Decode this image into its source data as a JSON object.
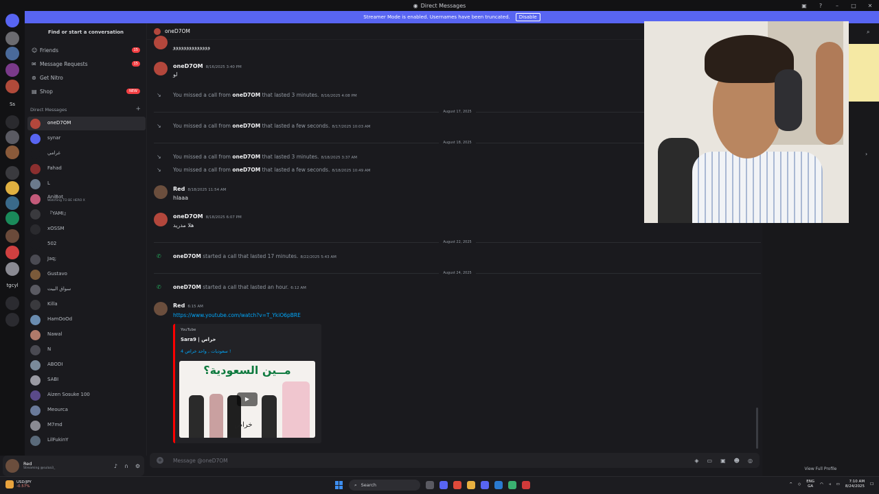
{
  "window": {
    "title": "Direct Messages"
  },
  "banner": {
    "text": "Streamer Mode is enabled. Usernames have been truncated.",
    "button": "Disable"
  },
  "sidebar": {
    "search": "Find or start a conversation",
    "nav": [
      {
        "label": "Friends",
        "icon": "friends-icon",
        "badge": "15"
      },
      {
        "label": "Message Requests",
        "icon": "mail-icon",
        "badge": "15"
      },
      {
        "label": "Get Nitro",
        "icon": "nitro-icon",
        "badge": ""
      },
      {
        "label": "Shop",
        "icon": "shop-icon",
        "badge": "NEW"
      }
    ],
    "dm_header": "Direct Messages",
    "dms": [
      {
        "name": "oneD7OM",
        "sub": "",
        "color": "#b3473c"
      },
      {
        "name": "synar",
        "sub": "",
        "color": "#5865f2"
      },
      {
        "name": "غرامي",
        "sub": "",
        "color": "#1a1a1e"
      },
      {
        "name": "Fahad",
        "sub": "",
        "color": "#8b2f2f"
      },
      {
        "name": "L",
        "sub": "",
        "color": "#6b7a8c"
      },
      {
        "name": "AniBot",
        "sub": "Watching TO BE HERO X",
        "color": "#c45a7a"
      },
      {
        "name": "『YAMI』",
        "sub": "",
        "color": "#3a3a3e"
      },
      {
        "name": "xOSSM",
        "sub": "",
        "color": "#2a2a2e"
      },
      {
        "name": "502",
        "sub": "",
        "color": "#1a1a1e"
      },
      {
        "name": "Jaq;",
        "sub": "",
        "color": "#4a4a52"
      },
      {
        "name": "Gustavo",
        "sub": "",
        "color": "#7a5a3a"
      },
      {
        "name": "سواق البيت",
        "sub": "",
        "color": "#5a5a62"
      },
      {
        "name": "Killa",
        "sub": "",
        "color": "#3a3a3e"
      },
      {
        "name": "HamOoOd",
        "sub": "",
        "color": "#6a8cb0"
      },
      {
        "name": "Nawal",
        "sub": "",
        "color": "#b07a6a"
      },
      {
        "name": "N",
        "sub": "",
        "color": "#4a4a52"
      },
      {
        "name": "ABODI",
        "sub": "",
        "color": "#7a8a9a"
      },
      {
        "name": "SABI",
        "sub": "",
        "color": "#9a9aa2"
      },
      {
        "name": "Aizen Sosuke 100",
        "sub": "",
        "color": "#5a4a8a"
      },
      {
        "name": "Meourca",
        "sub": "",
        "color": "#6a7a9a"
      },
      {
        "name": "M7md",
        "sub": "",
        "color": "#8a8a92"
      },
      {
        "name": "LilFukinY",
        "sub": "",
        "color": "#5a6a7a"
      }
    ]
  },
  "user_panel": {
    "name": "Red",
    "status": "Streaming @sulaa3_"
  },
  "chat": {
    "channel": "oneD7OM",
    "top_partial": "وووووووووووووو",
    "messages": [
      {
        "author": "oneD7OM",
        "ts": "8/16/2025 3:40 PM",
        "body": "لو"
      },
      {
        "sys_pre": "You missed a call from",
        "who": "oneD7OM",
        "sys_post": "that lasted 3 minutes.",
        "ts": "8/16/2025 4:08 PM"
      },
      {
        "divider": "August 17, 2025"
      },
      {
        "sys_pre": "You missed a call from",
        "who": "oneD7OM",
        "sys_post": "that lasted a few seconds.",
        "ts": "8/17/2025 10:03 AM"
      },
      {
        "divider": "August 18, 2025"
      },
      {
        "sys_pre": "You missed a call from",
        "who": "oneD7OM",
        "sys_post": "that lasted 3 minutes.",
        "ts": "8/18/2025 3:37 AM"
      },
      {
        "sys_pre": "You missed a call from",
        "who": "oneD7OM",
        "sys_post": "that lasted a few seconds.",
        "ts": "8/18/2025 10:49 AM"
      },
      {
        "author": "Red",
        "ts": "8/18/2025 11:54 AM",
        "body": "hlaaa"
      },
      {
        "author": "oneD7OM",
        "ts": "8/18/2025 6:07 PM",
        "body": "هلا مدريد"
      },
      {
        "divider": "August 22, 2025"
      },
      {
        "who": "oneD7OM",
        "sys_post": "started a call that lasted 17 minutes.",
        "ts": "8/22/2025 5:43 AM"
      },
      {
        "divider": "August 24, 2025"
      },
      {
        "who": "oneD7OM",
        "sys_post": "started a call that lasted an hour.",
        "ts": "6:12 AM"
      },
      {
        "author": "Red",
        "ts": "6:15 AM",
        "link": "https://www.youtube.com/watch?v=T_YkiO6pBRE"
      }
    ],
    "embed": {
      "provider": "YouTube",
      "title": "Sara9 | خراص",
      "desc": "4 سعوديات , واحد خراص !",
      "thumb_headline": "مــين السعودية؟",
      "thumb_logo": "خراص"
    },
    "composer_placeholder": "Message @oneD7OM"
  },
  "profile": {
    "full_profile": "View Full Profile"
  },
  "taskbar": {
    "ticker": "USD/JPY",
    "ticker_change": "-0.57%",
    "search": "Search",
    "lang": "ENG",
    "region": "GA",
    "time": "7:10 AM",
    "date": "8/24/2025"
  },
  "colors": {
    "accent": "#5865f2",
    "link": "#00a8fc",
    "call_missed": "#949ba4",
    "call_ok": "#23a55a",
    "badge": "#f23f43"
  }
}
